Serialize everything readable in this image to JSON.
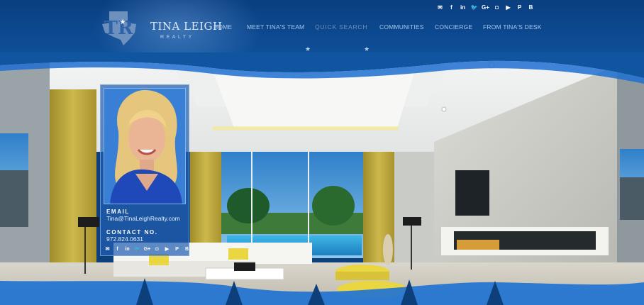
{
  "brand": {
    "name": "TINA LEIGH",
    "sub": "REALTY"
  },
  "nav": {
    "items": [
      {
        "label": "HOME"
      },
      {
        "label": "MEET TINA'S TEAM"
      },
      {
        "label": "QUICK SEARCH"
      },
      {
        "label": "COMMUNITIES"
      },
      {
        "label": "CONCIERGE"
      },
      {
        "label": "FROM TINA'S DESK"
      }
    ],
    "active": "QUICK SEARCH"
  },
  "social": [
    {
      "icon": "email-icon",
      "glyph": "✉"
    },
    {
      "icon": "facebook-icon",
      "glyph": "f"
    },
    {
      "icon": "linkedin-icon",
      "glyph": "in"
    },
    {
      "icon": "twitter-icon",
      "glyph": "🐦"
    },
    {
      "icon": "google-plus-icon",
      "glyph": "G+"
    },
    {
      "icon": "instagram-icon",
      "glyph": "◘"
    },
    {
      "icon": "youtube-icon",
      "glyph": "▶"
    },
    {
      "icon": "pinterest-icon",
      "glyph": "P"
    },
    {
      "icon": "blogger-icon",
      "glyph": "B"
    }
  ],
  "agent": {
    "email_label": "EMAIL",
    "email": "Tina@TinaLeighRealty.com",
    "contact_label": "CONTACT NO.",
    "phone": "972.824.0631"
  },
  "colors": {
    "header": "#0d4b93",
    "accent": "#1f6fd1",
    "nav_text": "#a9c8ec",
    "curtain": "#b9a43a",
    "pillow": "#e9d641"
  }
}
